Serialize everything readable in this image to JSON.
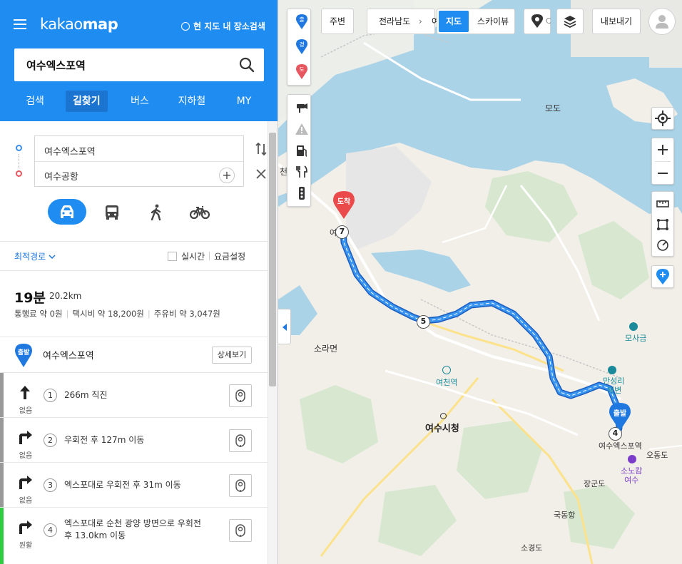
{
  "header": {
    "logo_prefix": "kakao",
    "logo_suffix": "map",
    "map_search_toggle": "현 지도 내 장소검색"
  },
  "search": {
    "value": "여수엑스포역"
  },
  "tabs": [
    {
      "label": "검색",
      "active": false
    },
    {
      "label": "길찾기",
      "active": true
    },
    {
      "label": "버스",
      "active": false
    },
    {
      "label": "지하철",
      "active": false
    },
    {
      "label": "MY",
      "active": false
    }
  ],
  "route": {
    "origin": "여수엑스포역",
    "destination": "여수공항"
  },
  "modes": [
    {
      "name": "car",
      "active": true
    },
    {
      "name": "bus",
      "active": false
    },
    {
      "name": "walk",
      "active": false
    },
    {
      "name": "bike",
      "active": false
    }
  ],
  "options": {
    "sort": "최적경로",
    "realtime": "실시간",
    "fee_setting": "요금설정"
  },
  "summary": {
    "duration": "19분",
    "distance": "20.2km",
    "toll": "통행료 약 0원",
    "taxi": "택시비 약 18,200원",
    "fuel": "주유비 약 3,047원"
  },
  "start": {
    "badge": "출발",
    "name": "여수엑스포역",
    "detail_button": "상세보기"
  },
  "steps": [
    {
      "num": "1",
      "desc_lines": [
        "266m 직진"
      ],
      "condition": "없음",
      "arrow": "straight-arrow-icon",
      "bar_color": "#999999"
    },
    {
      "num": "2",
      "desc_lines": [
        "우회전 후 127m 이동"
      ],
      "condition": "없음",
      "arrow": "right-turn-arrow-icon",
      "bar_color": "#999999"
    },
    {
      "num": "3",
      "desc_lines": [
        "엑스포대로 우회전 후 31m 이동"
      ],
      "condition": "없음",
      "arrow": "right-turn-arrow-icon",
      "bar_color": "#999999"
    },
    {
      "num": "4",
      "desc_lines": [
        "엑스포대로 순천 광양 방면으로 우회전",
        "후 13.0km 이동"
      ],
      "condition": "원활",
      "arrow": "right-turn-arrow-icon",
      "bar_color": "#2ecc40"
    }
  ],
  "map": {
    "left_pins": [
      {
        "label": "출",
        "color": "#1f78e0"
      },
      {
        "label": "경",
        "color": "#1f78e0"
      },
      {
        "label": "도",
        "color": "#e6565f"
      }
    ],
    "toolbar": {
      "nearby": "주변",
      "region": "전라남도",
      "region_partial": "여",
      "map_type": "지도",
      "skyview": "스카이뷰",
      "cut_text": "C",
      "export": "내보내기"
    },
    "labels": {
      "modo": "모도",
      "sorameon": "소라면",
      "yeocheon_station": "여천역",
      "city_hall": "여수시청",
      "expo_station": "여수엑스포역",
      "airport_partial": "여     항",
      "osu": "오동도",
      "hanwha_line1": "소노캄",
      "hanwha_line2": "여수",
      "jangundo": "장군도",
      "gukdonghang": "국동항",
      "sogyeongdo": "소경도",
      "mosageum": "모사금",
      "mansung_line1": "만성리",
      "mansung_line2": "해변",
      "cheon_partial": "천"
    },
    "markers": {
      "arrive": "도착",
      "depart": "출발",
      "route_num_7": "7",
      "route_num_5": "5",
      "route_num_4": "4"
    }
  },
  "colors": {
    "brand_blue": "#1f8cf2",
    "route_blue": "#2f86ee",
    "arrive_red": "#ea4a4a",
    "sea": "#aad3e8",
    "land": "#f2efe9"
  }
}
